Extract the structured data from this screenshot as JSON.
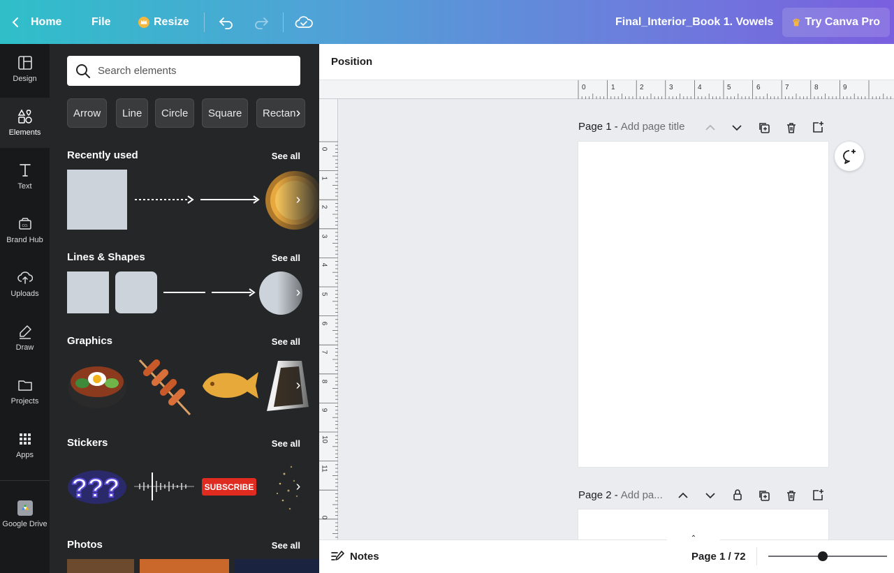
{
  "topbar": {
    "home": "Home",
    "file": "File",
    "resize": "Resize",
    "doc_title": "Final_Interior_Book 1. Vowels",
    "pro": "Try Canva Pro"
  },
  "rail": {
    "items": [
      {
        "label": "Design",
        "icon": "design-icon"
      },
      {
        "label": "Elements",
        "icon": "shapes-icon",
        "active": true
      },
      {
        "label": "Text",
        "icon": "text-icon"
      },
      {
        "label": "Brand Hub",
        "icon": "brand-icon"
      },
      {
        "label": "Uploads",
        "icon": "upload-icon"
      },
      {
        "label": "Draw",
        "icon": "draw-icon"
      },
      {
        "label": "Projects",
        "icon": "folder-icon"
      },
      {
        "label": "Apps",
        "icon": "apps-icon"
      },
      {
        "label": "Google Drive",
        "icon": "google-drive-icon"
      }
    ]
  },
  "panel": {
    "search_placeholder": "Search elements",
    "chips": [
      "Arrow",
      "Line",
      "Circle",
      "Square",
      "Rectan"
    ],
    "sections": [
      {
        "title": "Recently used",
        "see_all": "See all"
      },
      {
        "title": "Lines & Shapes",
        "see_all": "See all"
      },
      {
        "title": "Graphics",
        "see_all": "See all"
      },
      {
        "title": "Stickers",
        "see_all": "See all"
      },
      {
        "title": "Photos",
        "see_all": "See all"
      }
    ],
    "sticker_subscribe": "SUBSCRIBE"
  },
  "canvas": {
    "position_label": "Position",
    "ruler_h": [
      "0",
      "1",
      "2",
      "3",
      "4",
      "5",
      "6",
      "7",
      "8",
      "9"
    ],
    "ruler_v": [
      "0",
      "1",
      "2",
      "3",
      "4",
      "5",
      "6",
      "7",
      "8",
      "9",
      "10",
      "11",
      "0"
    ],
    "page1": {
      "label": "Page 1 -",
      "title_placeholder": "Add page title"
    },
    "page2": {
      "label": "Page 2 -",
      "title_placeholder": "Add pa..."
    }
  },
  "bottombar": {
    "notes": "Notes",
    "page_count": "Page 1 / 72"
  },
  "colors": {
    "gradient_start": "#2fbfc9",
    "gradient_end": "#7a5fde",
    "panel_bg": "#252627",
    "rail_bg": "#18191b",
    "crown": "#f4b740",
    "subscribe_red": "#e02b20"
  }
}
